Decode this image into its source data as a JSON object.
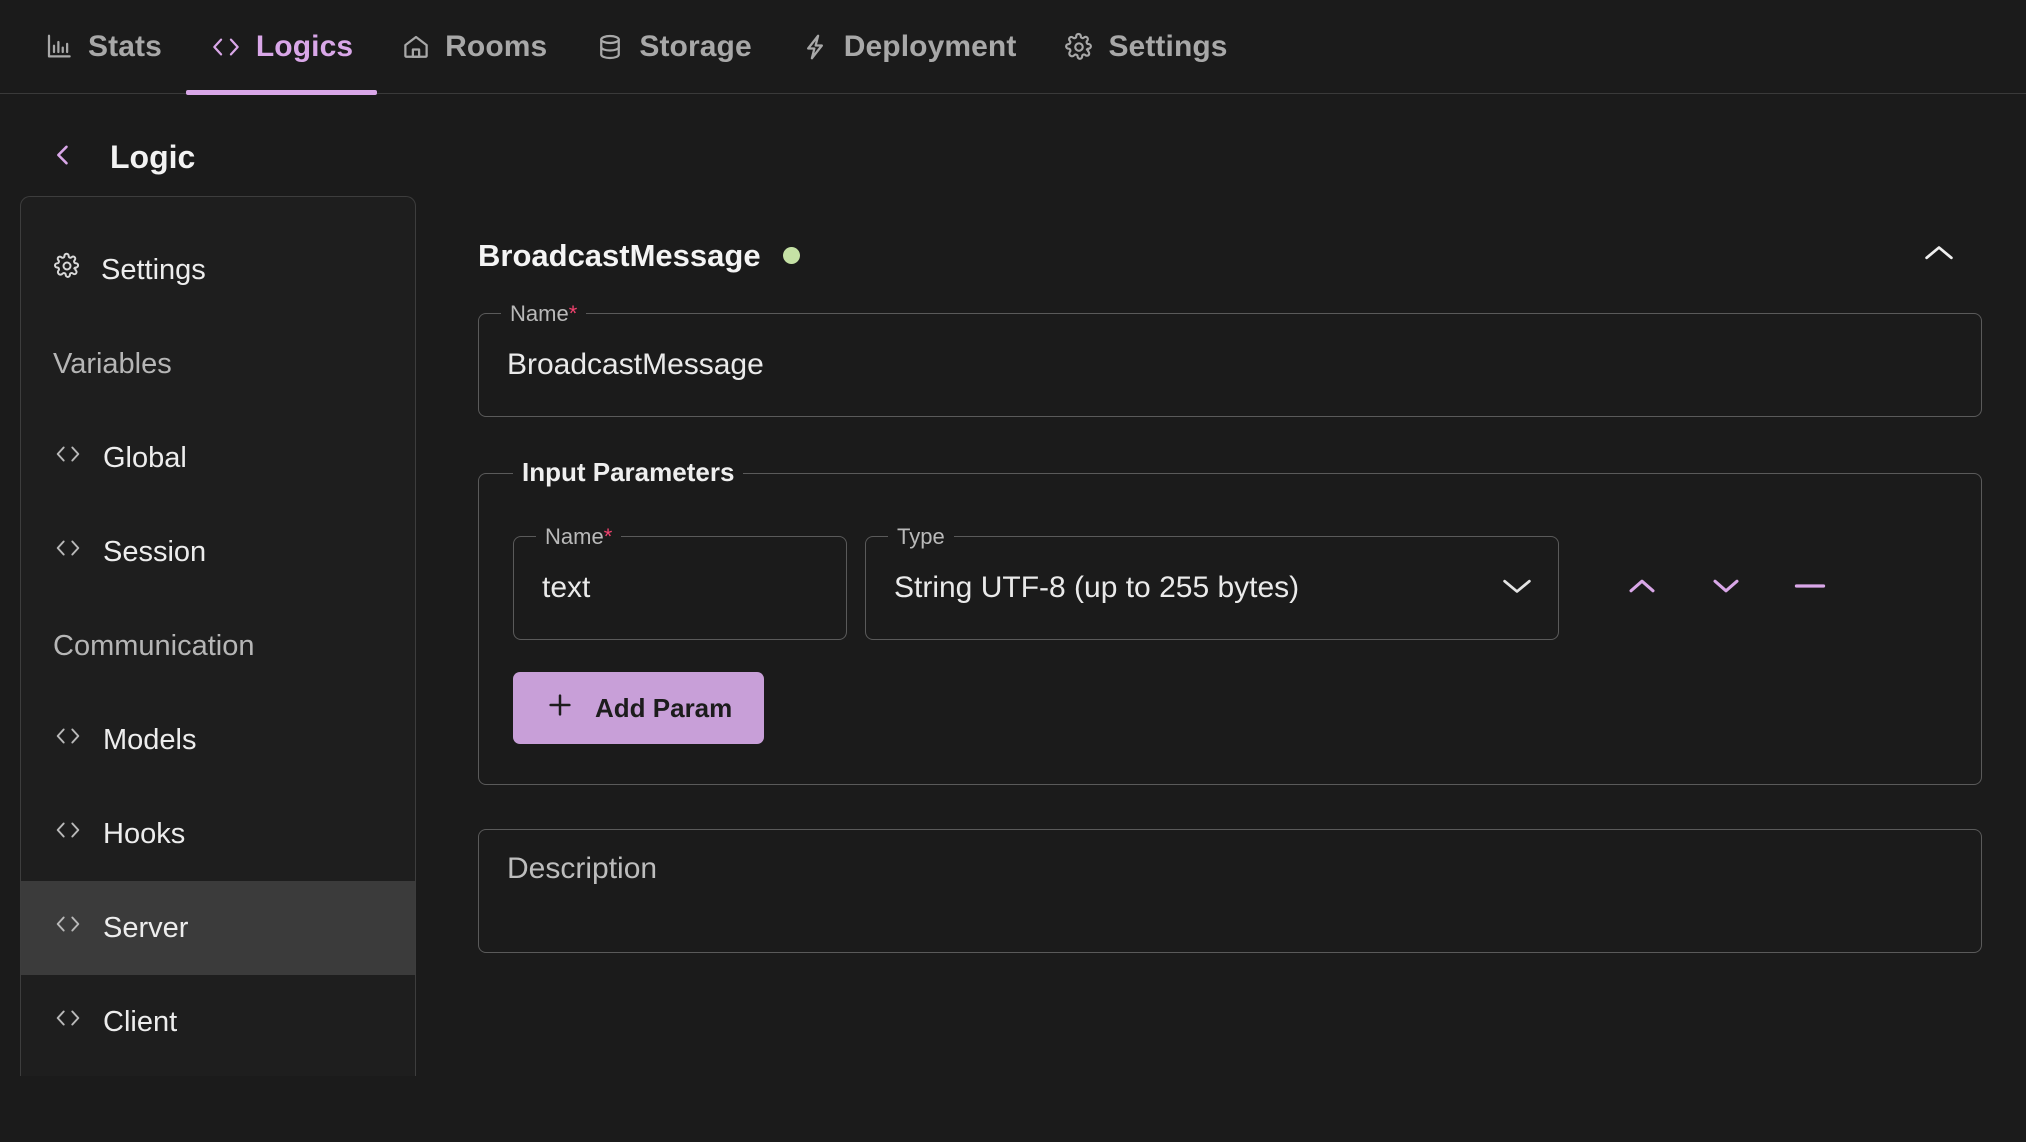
{
  "topnav": {
    "tabs": [
      {
        "label": "Stats",
        "icon": "bar-chart-icon",
        "active": false
      },
      {
        "label": "Logics",
        "icon": "code-brackets-icon",
        "active": true
      },
      {
        "label": "Rooms",
        "icon": "home-icon",
        "active": false
      },
      {
        "label": "Storage",
        "icon": "database-icon",
        "active": false
      },
      {
        "label": "Deployment",
        "icon": "lightning-bolt-icon",
        "active": false
      },
      {
        "label": "Settings",
        "icon": "gear-icon",
        "active": false
      }
    ]
  },
  "header": {
    "back_icon": "chevron-left-icon",
    "title": "Logic"
  },
  "sidebar": {
    "items": [
      {
        "label": "Settings",
        "icon": "gear-icon",
        "kind": "item",
        "selected": false
      },
      {
        "label": "Variables",
        "icon": "",
        "kind": "section",
        "selected": false
      },
      {
        "label": "Global",
        "icon": "code-brackets-icon",
        "kind": "item",
        "selected": false
      },
      {
        "label": "Session",
        "icon": "code-brackets-icon",
        "kind": "item",
        "selected": false
      },
      {
        "label": "Communication",
        "icon": "",
        "kind": "section",
        "selected": false
      },
      {
        "label": "Models",
        "icon": "code-brackets-icon",
        "kind": "item",
        "selected": false
      },
      {
        "label": "Hooks",
        "icon": "code-brackets-icon",
        "kind": "item",
        "selected": false
      },
      {
        "label": "Server",
        "icon": "code-brackets-icon",
        "kind": "item",
        "selected": true
      },
      {
        "label": "Client",
        "icon": "code-brackets-icon",
        "kind": "item",
        "selected": false
      }
    ]
  },
  "logic_card": {
    "title": "BroadcastMessage",
    "status_dot_color": "#c5e1a5",
    "collapse_icon": "chevron-up-icon",
    "name_field": {
      "label": "Name",
      "required_marker": "*",
      "value": "BroadcastMessage"
    },
    "input_parameters": {
      "legend": "Input Parameters",
      "rows": [
        {
          "name_label": "Name",
          "name_required_marker": "*",
          "name_value": "text",
          "type_label": "Type",
          "type_value": "String UTF-8 (up to 255 bytes)",
          "type_dropdown_icon": "chevron-down-icon",
          "move_up_icon": "chevron-up-icon",
          "move_down_icon": "chevron-down-icon",
          "remove_icon": "minus-icon"
        }
      ],
      "add_button": {
        "label": "Add Param",
        "icon": "plus-icon"
      }
    },
    "description": {
      "placeholder": "Description",
      "value": ""
    }
  },
  "colors": {
    "accent": "#d9a7e8",
    "accent_button": "#c89fd8",
    "required": "#f0426e",
    "status_ok": "#c5e1a5",
    "background": "#1b1b1b",
    "selected_row": "#3b3b3b"
  }
}
